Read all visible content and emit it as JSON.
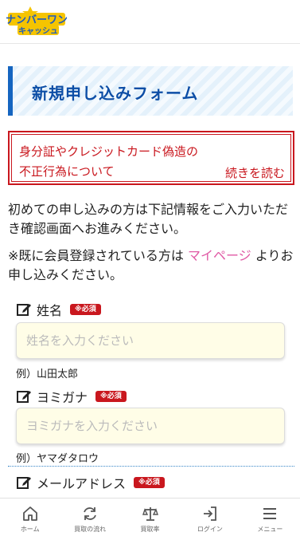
{
  "header": {
    "logo_line1": "ナンバーワン",
    "logo_line2": "キャッシュ"
  },
  "page": {
    "title": "新規申し込みフォーム"
  },
  "notice": {
    "line1": "身分証やクレジットカード偽造の",
    "line2": "不正行為について",
    "link": "続きを読む"
  },
  "intro": {
    "text": "初めての申し込みの方は下記情報をご入力いただき確認画面へお進みください。",
    "member_prefix": "※既に会員登録されている方は",
    "member_link": "マイページ",
    "member_suffix": "よりお申し込みください。"
  },
  "form": {
    "required_badge": "※必須",
    "fields": [
      {
        "label": "姓名",
        "placeholder": "姓名を入力ください",
        "example": "例）山田太郎"
      },
      {
        "label": "ヨミガナ",
        "placeholder": "ヨミガナを入力ください",
        "example": "例）ヤマダタロウ"
      },
      {
        "label": "メールアドレス"
      }
    ]
  },
  "nav": {
    "items": [
      {
        "label": "ホーム",
        "icon": "home-icon"
      },
      {
        "label": "買取の流れ",
        "icon": "refresh-icon"
      },
      {
        "label": "買取率",
        "icon": "scale-icon"
      },
      {
        "label": "ログイン",
        "icon": "login-icon"
      },
      {
        "label": "メニュー",
        "icon": "menu-icon"
      }
    ]
  },
  "colors": {
    "accent_blue": "#0d4ea6",
    "alert_red": "#c9171e",
    "link_pink": "#e05aa5",
    "input_bg": "#fffde7"
  }
}
